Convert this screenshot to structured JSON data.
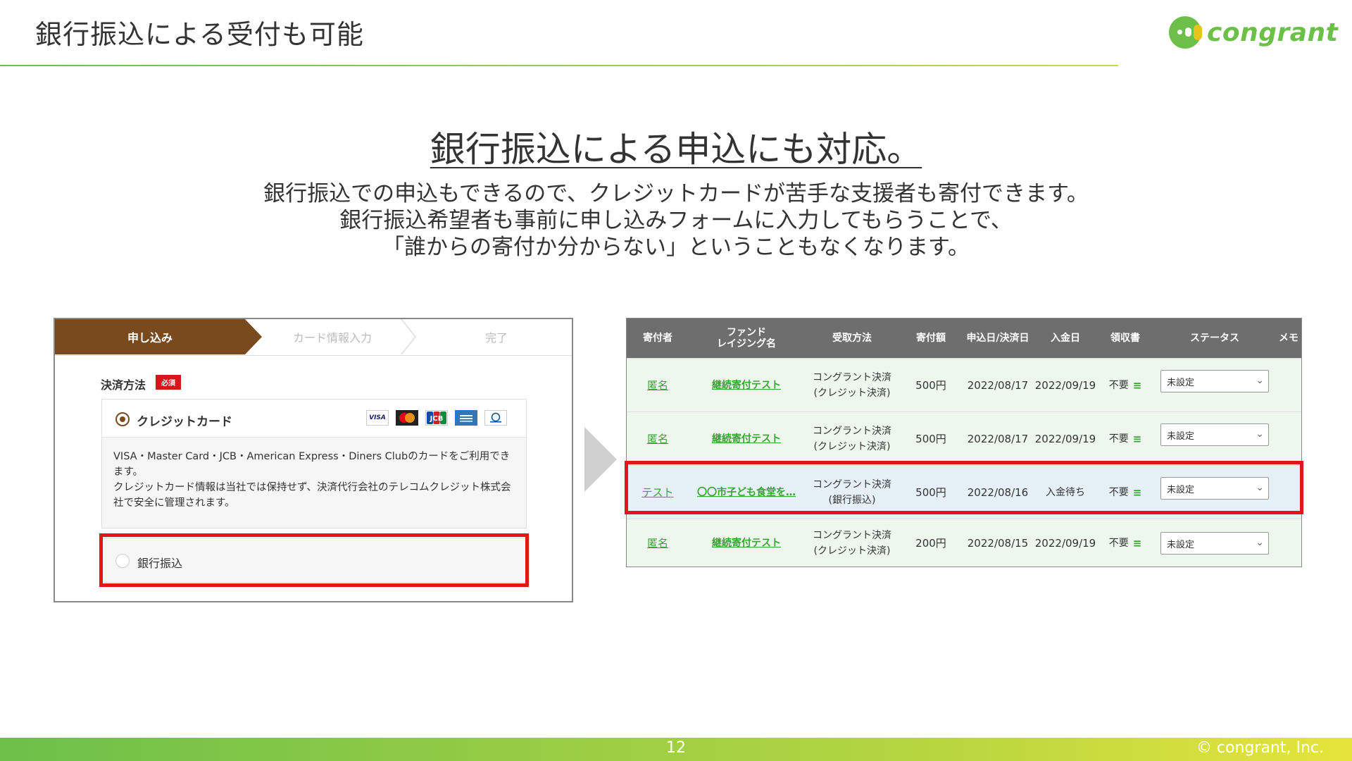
{
  "slide": {
    "title": "銀行振込による受付も可能",
    "heading": "銀行振込による申込にも対応。",
    "body_lines": [
      "銀行振込での申込もできるので、クレジットカードが苦手な支援者も寄付できます。",
      "銀行振込希望者も事前に申し込みフォームに入力してもらうことで、",
      "「誰からの寄付か分からない」ということもなくなります。"
    ],
    "page_number": "12",
    "copyright": "© congrant, Inc."
  },
  "logo": {
    "text": "congrant",
    "icon": "congrant-logo-icon"
  },
  "colors": {
    "brand_green": "#6cc04a",
    "brown": "#7a4a1f",
    "highlight_red": "#e3141a",
    "link_green": "#3aa336"
  },
  "form": {
    "steps": [
      "申し込み",
      "カード情報入力",
      "完了"
    ],
    "payment_label": "決済方法",
    "required_badge": "必須",
    "credit_card": {
      "title": "クレジットカード",
      "brands": [
        "VISA",
        "Master Card",
        "JCB",
        "American Express",
        "Diners Club"
      ],
      "description_1": "VISA・Master Card・JCB・American Express・Diners Clubのカードをご利用できます。",
      "description_2": "クレジットカード情報は当社では保持せず、決済代行会社のテレコムクレジット株式会社で安全に管理されます。"
    },
    "bank_transfer_label": "銀行振込"
  },
  "table": {
    "headers": {
      "donor": "寄付者",
      "fund_1": "ファンド",
      "fund_2": "レイジング名",
      "method": "受取方法",
      "amount": "寄付額",
      "applied": "申込日/決済日",
      "paid": "入金日",
      "receipt": "領収書",
      "status": "ステータス",
      "memo": "メモ"
    },
    "rows": [
      {
        "donor": "匿名",
        "fund": "継続寄付テスト",
        "method_1": "コングラント決済",
        "method_2": "(クレジット決済)",
        "amount": "500円",
        "applied": "2022/08/17",
        "paid": "2022/09/19",
        "receipt": "不要",
        "status": "未設定"
      },
      {
        "donor": "匿名",
        "fund": "継続寄付テスト",
        "method_1": "コングラント決済",
        "method_2": "(クレジット決済)",
        "amount": "500円",
        "applied": "2022/08/17",
        "paid": "2022/09/19",
        "receipt": "不要",
        "status": "未設定"
      },
      {
        "donor": "テスト",
        "fund": "〇〇市子ども食堂を…",
        "method_1": "コングラント決済",
        "method_2": "(銀行振込)",
        "amount": "500円",
        "applied": "2022/08/16",
        "paid": "入金待ち",
        "receipt": "不要",
        "status": "未設定"
      },
      {
        "donor": "匿名",
        "fund": "継続寄付テスト",
        "method_1": "コングラント決済",
        "method_2": "(クレジット決済)",
        "amount": "200円",
        "applied": "2022/08/15",
        "paid": "2022/09/19",
        "receipt": "不要",
        "status": "未設定"
      }
    ]
  }
}
